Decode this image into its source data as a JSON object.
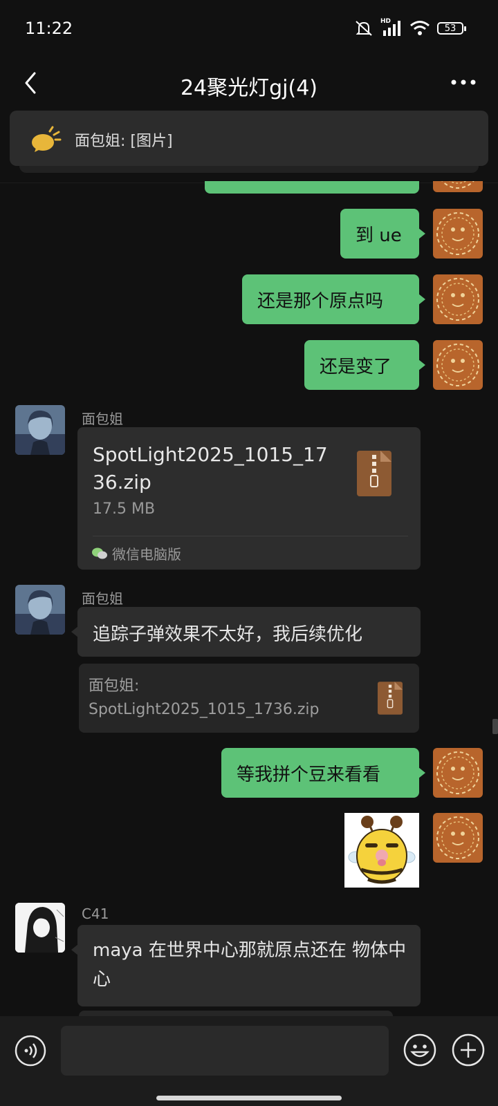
{
  "status": {
    "time": "11:22",
    "battery": "53",
    "network": "HD"
  },
  "nav": {
    "title": "24聚光灯gj(4)"
  },
  "pinned": {
    "text": "面包姐: [图片]"
  },
  "messages": {
    "m1": {
      "text": "到 ue"
    },
    "m2": {
      "text": "还是那个原点吗"
    },
    "m3": {
      "text": "还是变了"
    },
    "m4": {
      "sender": "面包姐",
      "file_name": "SpotLight2025_1015_1736.zip",
      "file_size": "17.5 MB",
      "source": "微信电脑版"
    },
    "m5": {
      "sender": "面包姐",
      "text": "追踪子弹效果不太好，我后续优化",
      "reply_sender": "面包姐:",
      "reply_file": "SpotLight2025_1015_1736.zip"
    },
    "m6": {
      "text": "等我拼个豆来看看"
    },
    "m8": {
      "sender": "C41",
      "text": "maya 在世界中心那就原点还在 物体中心"
    }
  },
  "colors": {
    "my_bubble": "#5dc277",
    "other_bubble": "#2d2d2d",
    "background": "#111111"
  },
  "icons": [
    "voice-icon",
    "emoji-icon",
    "plus-icon",
    "back-icon",
    "more-icon",
    "zip-file-icon",
    "wechat-icon"
  ]
}
